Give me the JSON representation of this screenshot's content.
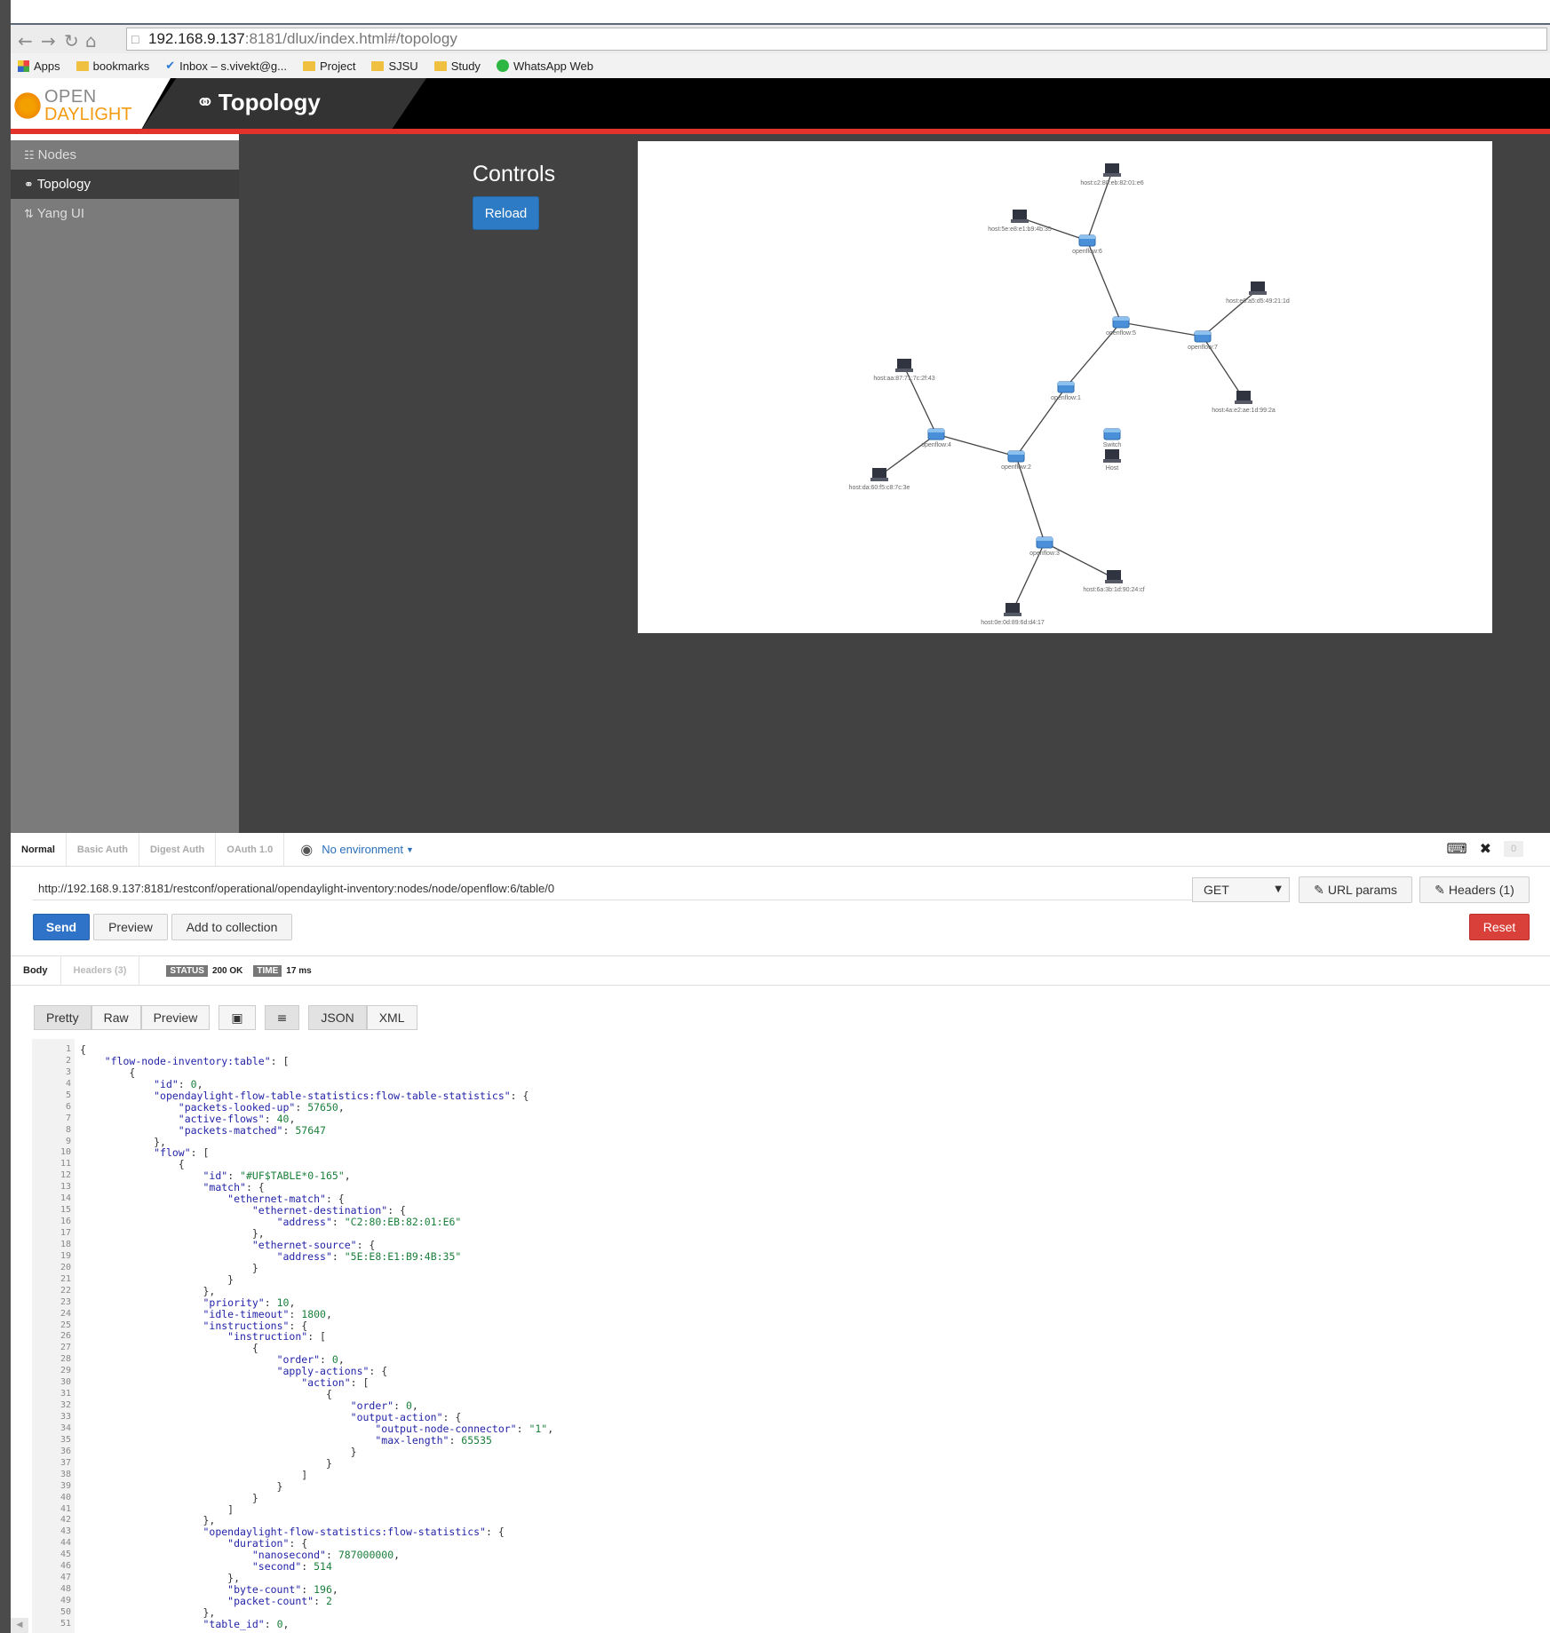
{
  "browser": {
    "url_host": "192.168.9.137",
    "url_rest": ":8181/dlux/index.html#/topology",
    "bookmarks": [
      {
        "label": "Apps",
        "icon": "apps-grid-icon"
      },
      {
        "label": "bookmarks",
        "icon": "folder-icon"
      },
      {
        "label": "Inbox – s.vivekt@g...",
        "icon": "inbox-check-icon"
      },
      {
        "label": "Project",
        "icon": "folder-icon"
      },
      {
        "label": "SJSU",
        "icon": "folder-icon"
      },
      {
        "label": "Study",
        "icon": "folder-icon"
      },
      {
        "label": "WhatsApp Web",
        "icon": "whatsapp-icon"
      }
    ]
  },
  "odl": {
    "logo_line1": "OPEN",
    "logo_line2": "DAYLIGHT",
    "page_title": "Topology",
    "sidebar": [
      {
        "label": "Nodes",
        "icon": "sitemap-icon",
        "active": false
      },
      {
        "label": "Topology",
        "icon": "link-icon",
        "active": true
      },
      {
        "label": "Yang UI",
        "icon": "sort-icon",
        "active": false
      }
    ],
    "controls_title": "Controls",
    "reload_label": "Reload",
    "topology": {
      "switches": [
        {
          "id": "openflow:6",
          "label": "openflow:6"
        },
        {
          "id": "openflow:5",
          "label": "openflow:5"
        },
        {
          "id": "openflow:7",
          "label": "openflow:7"
        },
        {
          "id": "openflow:1",
          "label": "openflow:1"
        },
        {
          "id": "openflow:4",
          "label": "openflow:4"
        },
        {
          "id": "openflow:2",
          "label": "openflow:2"
        },
        {
          "id": "openflow:3",
          "label": "openflow:3"
        }
      ],
      "hosts": [
        {
          "label": "host:c2:80:eb:82:01:e6"
        },
        {
          "label": "host:5e:e8:e1:b9:4b:35"
        },
        {
          "label": "host:e6:a5:d5:49:21:1d"
        },
        {
          "label": "host:4a:e2:ae:1d:99:2a"
        },
        {
          "label": "host:aa:87:71:7c:2f:43"
        },
        {
          "label": "host:da:60:f5:c8:7c:3e"
        },
        {
          "label": "host:6a:3b:1d:90:24:cf"
        },
        {
          "label": "host:0e:0d:89:6d:d4:17"
        }
      ],
      "legend": {
        "switch": "Switch",
        "host": "Host"
      }
    }
  },
  "postman": {
    "auth_tabs": [
      "Normal",
      "Basic Auth",
      "Digest Auth",
      "OAuth 1.0"
    ],
    "environment": "No environment",
    "env_badge": "0",
    "request_url": "http://192.168.9.137:8181/restconf/operational/opendaylight-inventory:nodes/node/openflow:6/table/0",
    "method": "GET",
    "url_params": "URL params",
    "headers_btn": "Headers (1)",
    "send": "Send",
    "preview": "Preview",
    "add_to_collection": "Add to collection",
    "reset": "Reset",
    "resp_tabs": [
      "Body",
      "Headers (3)"
    ],
    "status_label": "STATUS",
    "status_value": "200 OK",
    "time_label": "TIME",
    "time_value": "17 ms",
    "format_buttons": [
      "Pretty",
      "Raw",
      "Preview"
    ],
    "format_types": [
      "JSON",
      "XML"
    ],
    "code": [
      "{",
      "    \"flow-node-inventory:table\": [",
      "        {",
      "            \"id\": 0,",
      "            \"opendaylight-flow-table-statistics:flow-table-statistics\": {",
      "                \"packets-looked-up\": 57650,",
      "                \"active-flows\": 40,",
      "                \"packets-matched\": 57647",
      "            },",
      "            \"flow\": [",
      "                {",
      "                    \"id\": \"#UF$TABLE*0-165\",",
      "                    \"match\": {",
      "                        \"ethernet-match\": {",
      "                            \"ethernet-destination\": {",
      "                                \"address\": \"C2:80:EB:82:01:E6\"",
      "                            },",
      "                            \"ethernet-source\": {",
      "                                \"address\": \"5E:E8:E1:B9:4B:35\"",
      "                            }",
      "                        }",
      "                    },",
      "                    \"priority\": 10,",
      "                    \"idle-timeout\": 1800,",
      "                    \"instructions\": {",
      "                        \"instruction\": [",
      "                            {",
      "                                \"order\": 0,",
      "                                \"apply-actions\": {",
      "                                    \"action\": [",
      "                                        {",
      "                                            \"order\": 0,",
      "                                            \"output-action\": {",
      "                                                \"output-node-connector\": \"1\",",
      "                                                \"max-length\": 65535",
      "                                            }",
      "                                        }",
      "                                    ]",
      "                                }",
      "                            }",
      "                        ]",
      "                    },",
      "                    \"opendaylight-flow-statistics:flow-statistics\": {",
      "                        \"duration\": {",
      "                            \"nanosecond\": 787000000,",
      "                            \"second\": 514",
      "                        },",
      "                        \"byte-count\": 196,",
      "                        \"packet-count\": 2",
      "                    },",
      "                    \"table_id\": 0,"
    ]
  }
}
